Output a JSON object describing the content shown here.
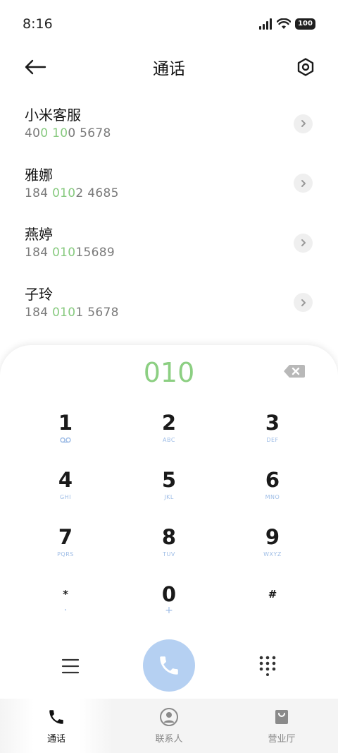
{
  "status": {
    "time": "8:16",
    "battery": "100"
  },
  "header": {
    "title": "通话"
  },
  "contacts": [
    {
      "name": "小米客服",
      "num": [
        {
          "t": "40",
          "hl": false
        },
        {
          "t": "0",
          "hl": true
        },
        {
          "t": " ",
          "hl": false
        },
        {
          "t": "10",
          "hl": true
        },
        {
          "t": "0 5678",
          "hl": false
        }
      ]
    },
    {
      "name": "雅娜",
      "num": [
        {
          "t": "184 ",
          "hl": false
        },
        {
          "t": "010",
          "hl": true
        },
        {
          "t": "2 4685",
          "hl": false
        }
      ]
    },
    {
      "name": "燕婷",
      "num": [
        {
          "t": "184 ",
          "hl": false
        },
        {
          "t": "010",
          "hl": true
        },
        {
          "t": "15689",
          "hl": false
        }
      ]
    },
    {
      "name": "子玲",
      "num": [
        {
          "t": "184 ",
          "hl": false
        },
        {
          "t": "010",
          "hl": true
        },
        {
          "t": "1 5678",
          "hl": false
        }
      ]
    }
  ],
  "dialer": {
    "input": "010"
  },
  "keypad": {
    "k1": {
      "digit": "1"
    },
    "k2": {
      "digit": "2",
      "letters": "ABC"
    },
    "k3": {
      "digit": "3",
      "letters": "DEF"
    },
    "k4": {
      "digit": "4",
      "letters": "GHI"
    },
    "k5": {
      "digit": "5",
      "letters": "JKL"
    },
    "k6": {
      "digit": "6",
      "letters": "MNO"
    },
    "k7": {
      "digit": "7",
      "letters": "PQRS"
    },
    "k8": {
      "digit": "8",
      "letters": "TUV"
    },
    "k9": {
      "digit": "9",
      "letters": "WXYZ"
    },
    "kstar": {
      "digit": "*",
      "sub": "·"
    },
    "k0": {
      "digit": "0",
      "sub": "+"
    },
    "khash": {
      "digit": "#"
    }
  },
  "nav": {
    "calls": "通话",
    "contacts": "联系人",
    "store": "营业厅"
  },
  "colors": {
    "match_highlight": "#86c97e",
    "call_button": "#b5d0f2",
    "key_letters": "#9dbce6"
  }
}
